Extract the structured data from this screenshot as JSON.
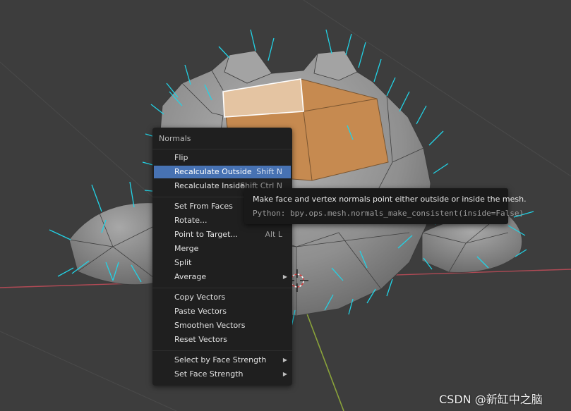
{
  "menu": {
    "title": "Normals",
    "items": [
      {
        "label": "Flip",
        "shortcut": ""
      },
      {
        "label": "Recalculate Outside",
        "shortcut": "Shift N"
      },
      {
        "label": "Recalculate Inside",
        "shortcut": "Shift Ctrl N"
      },
      {
        "label": "Set From Faces",
        "shortcut": ""
      },
      {
        "label": "Rotate...",
        "shortcut": ""
      },
      {
        "label": "Point to Target...",
        "shortcut": "Alt L"
      },
      {
        "label": "Merge",
        "shortcut": ""
      },
      {
        "label": "Split",
        "shortcut": ""
      },
      {
        "label": "Average",
        "shortcut": ""
      },
      {
        "label": "Copy Vectors",
        "shortcut": ""
      },
      {
        "label": "Paste Vectors",
        "shortcut": ""
      },
      {
        "label": "Smoothen Vectors",
        "shortcut": ""
      },
      {
        "label": "Reset Vectors",
        "shortcut": ""
      },
      {
        "label": "Select by Face Strength",
        "shortcut": ""
      },
      {
        "label": "Set Face Strength",
        "shortcut": ""
      }
    ],
    "highlighted": "Recalculate Outside",
    "submenu_arrow": "▶"
  },
  "tooltip": {
    "description": "Make face and vertex normals point either outside or inside the mesh.",
    "python": "Python: bpy.ops.mesh.normals_make_consistent(inside=False)"
  },
  "watermark": "CSDN @新缸中之脑",
  "colors": {
    "viewport_bg": "#3d3d3d",
    "mesh_face": "#8f8f8f",
    "selected_face": "#c68a50",
    "normal_lines": "#22d3e6",
    "menu_bg": "#1f1f1f",
    "menu_highlight": "#4772b3",
    "x_axis": "#b04a55",
    "y_axis": "#8aa33a"
  }
}
